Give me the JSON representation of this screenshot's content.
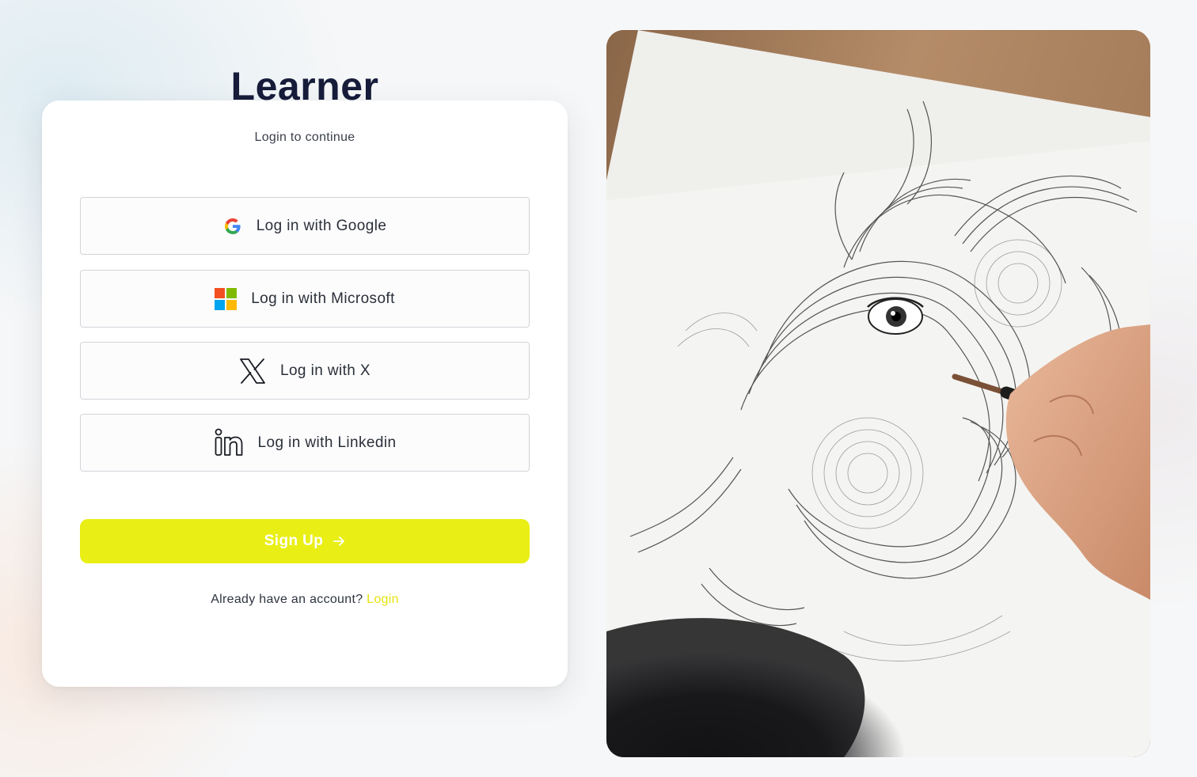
{
  "brand": {
    "title": "Learner"
  },
  "login": {
    "subtitle": "Login to continue",
    "providers": [
      {
        "label": "Log in with Google",
        "icon": "google-icon"
      },
      {
        "label": "Log in with Microsoft",
        "icon": "microsoft-icon"
      },
      {
        "label": "Log in with X",
        "icon": "x-icon"
      },
      {
        "label": "Log in with Linkedin",
        "icon": "linkedin-icon"
      }
    ],
    "signup_label": "Sign Up",
    "account_prompt": "Already have an account?",
    "login_link": "Login"
  },
  "colors": {
    "accent": "#e9ef15",
    "brand_text": "#161c3a",
    "link": "#e5e30d"
  }
}
